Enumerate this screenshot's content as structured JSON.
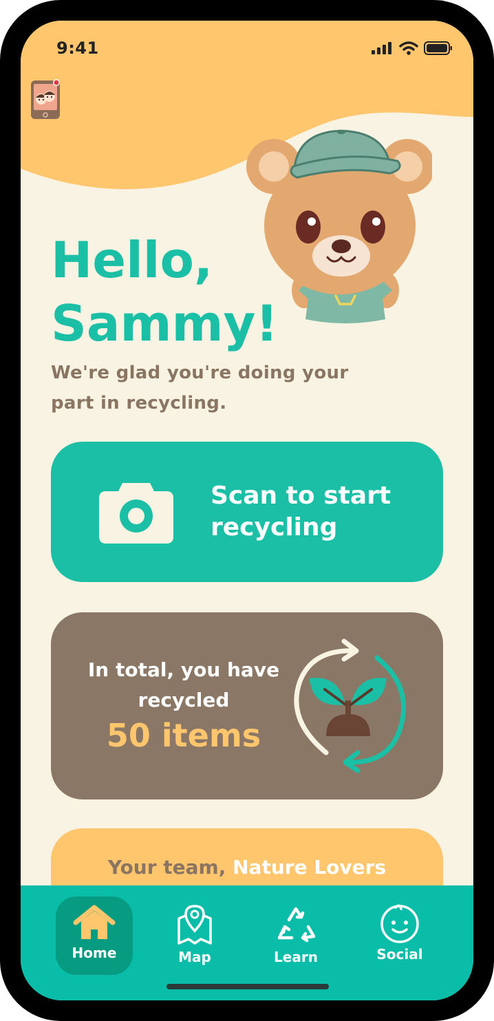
{
  "status_bar": {
    "time": "9:41"
  },
  "colors": {
    "header": "#FFC66E",
    "background": "#F8F3E2",
    "accent": "#1BBFA6",
    "card_brown": "#8B7765",
    "tabbar": "#0ABDA8",
    "tab_active": "#079C81",
    "highlight": "#FFC66E"
  },
  "header": {
    "family_button_icon": "family-phone-icon",
    "mascot_icon": "bear-mascot-icon"
  },
  "greeting": {
    "line1": "Hello,",
    "line2": "Sammy!",
    "subtitle": "We're glad you're doing your part in recycling."
  },
  "scan_card": {
    "icon": "camera-icon",
    "label": "Scan to start recycling"
  },
  "total_card": {
    "text": "In total, you have recycled",
    "count": "50 items",
    "icon": "recycle-sprout-icon"
  },
  "team_card": {
    "prefix": "Your team,",
    "name": "Nature Lovers"
  },
  "tabbar": {
    "tabs": [
      {
        "label": "Home",
        "icon": "home-icon",
        "active": true
      },
      {
        "label": "Map",
        "icon": "map-pin-icon",
        "active": false
      },
      {
        "label": "Learn",
        "icon": "recycle-icon",
        "active": false
      },
      {
        "label": "Social",
        "icon": "smiley-icon",
        "active": false
      }
    ]
  }
}
